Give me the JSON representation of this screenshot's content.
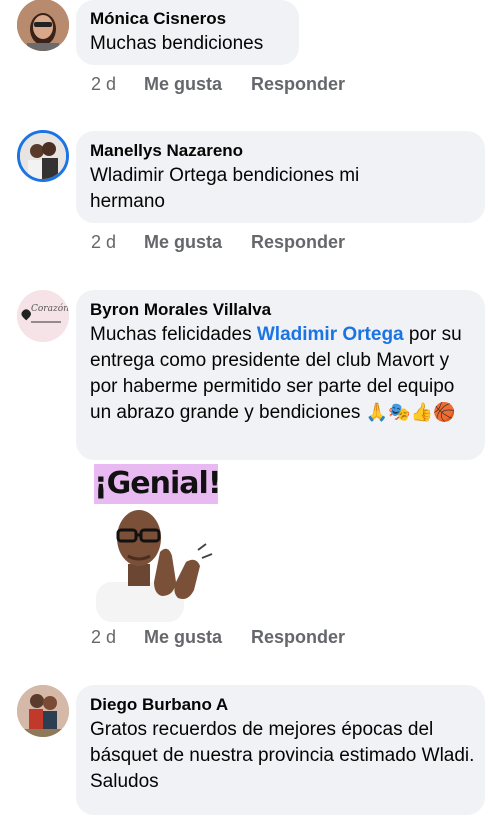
{
  "comments": [
    {
      "name": "Mónica Cisneros",
      "text": "Muchas bendiciones",
      "time": "2 d",
      "like": "Me gusta",
      "reply": "Responder"
    },
    {
      "name": "Manellys Nazareno",
      "text": "Wladimir Ortega bendiciones mi hermano",
      "time": "2 d",
      "like": "Me gusta",
      "reply": "Responder"
    },
    {
      "name": "Byron Morales Villalva",
      "text_before": "Muchas felicidades ",
      "mention": "Wladimir Ortega",
      "text_after": " por su entrega como presidente del club Mavort y por haberme permitido ser parte del equipo un abrazo grande y bendiciones",
      "emojis": "🙏🎭👍🏀",
      "sticker_text": "¡Genial!",
      "time": "2 d",
      "like": "Me gusta",
      "reply": "Responder"
    },
    {
      "name": "Diego Burbano A",
      "text": "Gratos recuerdos de mejores épocas del básquet de nuestra provincia estimado Wladi. Saludos"
    }
  ],
  "avatar_badge_text": "Corazón",
  "colors": {
    "bubble": "#f0f2f5",
    "secondary_text": "#65676b",
    "mention": "#1b74e4",
    "avatar_ring": "#1b74e4",
    "sticker_bg": "#e9b9f1"
  }
}
